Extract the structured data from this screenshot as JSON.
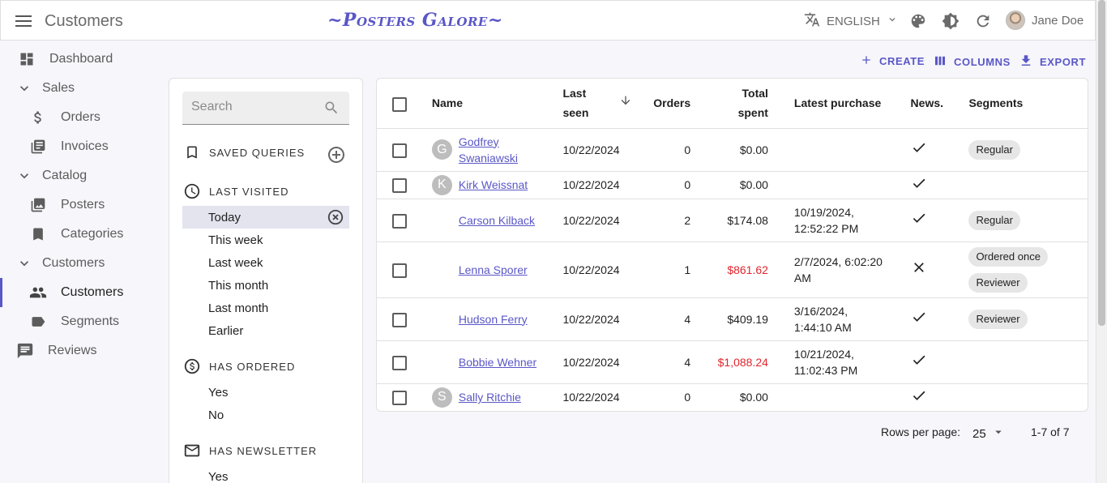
{
  "header": {
    "title": "Customers",
    "brand": "~Posters Galore~",
    "language": "ENGLISH",
    "user_name": "Jane Doe"
  },
  "sidebar": {
    "items": [
      {
        "label": "Dashboard",
        "icon": "dashboard-icon"
      },
      {
        "label": "Sales",
        "icon": "chevron-down-icon"
      },
      {
        "label": "Orders",
        "icon": "dollar-icon"
      },
      {
        "label": "Invoices",
        "icon": "invoice-icon"
      },
      {
        "label": "Catalog",
        "icon": "chevron-down-icon"
      },
      {
        "label": "Posters",
        "icon": "image-icon"
      },
      {
        "label": "Categories",
        "icon": "bookmark-icon"
      },
      {
        "label": "Customers",
        "icon": "chevron-down-icon"
      },
      {
        "label": "Customers",
        "icon": "people-icon"
      },
      {
        "label": "Segments",
        "icon": "label-icon"
      },
      {
        "label": "Reviews",
        "icon": "comment-icon"
      }
    ]
  },
  "filters": {
    "search_placeholder": "Search",
    "saved_queries": "SAVED QUERIES",
    "last_visited": {
      "title": "LAST VISITED",
      "items": [
        "Today",
        "This week",
        "Last week",
        "This month",
        "Last month",
        "Earlier"
      ],
      "selected": "Today"
    },
    "has_ordered": {
      "title": "HAS ORDERED",
      "items": [
        "Yes",
        "No"
      ]
    },
    "has_newsletter": {
      "title": "HAS NEWSLETTER",
      "items": [
        "Yes"
      ]
    }
  },
  "toolbar": {
    "create": "CREATE",
    "columns": "COLUMNS",
    "export": "EXPORT"
  },
  "table": {
    "headers": {
      "name": "Name",
      "last_seen_1": "Last",
      "last_seen_2": "seen",
      "orders": "Orders",
      "total_spent_1": "Total",
      "total_spent_2": "spent",
      "latest_purchase": "Latest purchase",
      "news": "News.",
      "segments": "Segments"
    },
    "rows": [
      {
        "avatar": "G",
        "name_1": "Godfrey",
        "name_2": "Swaniawski",
        "last_seen": "10/22/2024",
        "orders": "0",
        "total": "$0.00",
        "latest_1": "",
        "latest_2": "",
        "news": "✓",
        "seg_1": "Regular",
        "seg_2": ""
      },
      {
        "avatar": "K",
        "name_1": "Kirk Weissnat",
        "name_2": "",
        "last_seen": "10/22/2024",
        "orders": "0",
        "total": "$0.00",
        "latest_1": "",
        "latest_2": "",
        "news": "✓",
        "seg_1": "",
        "seg_2": ""
      },
      {
        "avatar": "",
        "name_1": "Carson Kilback",
        "name_2": "",
        "last_seen": "10/22/2024",
        "orders": "2",
        "total": "$174.08",
        "latest_1": "10/19/2024,",
        "latest_2": "12:52:22 PM",
        "news": "✓",
        "seg_1": "Regular",
        "seg_2": ""
      },
      {
        "avatar": "",
        "name_1": "Lenna Sporer",
        "name_2": "",
        "last_seen": "10/22/2024",
        "orders": "1",
        "total": "$861.62",
        "latest_1": "2/7/2024, 6:02:20",
        "latest_2": "AM",
        "news": "✕",
        "seg_1": "Ordered once",
        "seg_2": "Reviewer"
      },
      {
        "avatar": "",
        "name_1": "Hudson Ferry",
        "name_2": "",
        "last_seen": "10/22/2024",
        "orders": "4",
        "total": "$409.19",
        "latest_1": "3/16/2024,",
        "latest_2": "1:44:10 AM",
        "news": "✓",
        "seg_1": "Reviewer",
        "seg_2": ""
      },
      {
        "avatar": "",
        "name_1": "Bobbie Wehner",
        "name_2": "",
        "last_seen": "10/22/2024",
        "orders": "4",
        "total": "$1,088.24",
        "latest_1": "10/21/2024,",
        "latest_2": "11:02:43 PM",
        "news": "✓",
        "seg_1": "",
        "seg_2": ""
      },
      {
        "avatar": "S",
        "name_1": "Sally Ritchie",
        "name_2": "",
        "last_seen": "10/22/2024",
        "orders": "0",
        "total": "$0.00",
        "latest_1": "",
        "latest_2": "",
        "news": "✓",
        "seg_1": "",
        "seg_2": ""
      }
    ]
  },
  "pagination": {
    "rows_per_page_label": "Rows per page:",
    "rows_per_page": "25",
    "range": "1-7 of 7"
  },
  "colors": {
    "accent": "#5a57c7",
    "danger": "#e0262e"
  }
}
